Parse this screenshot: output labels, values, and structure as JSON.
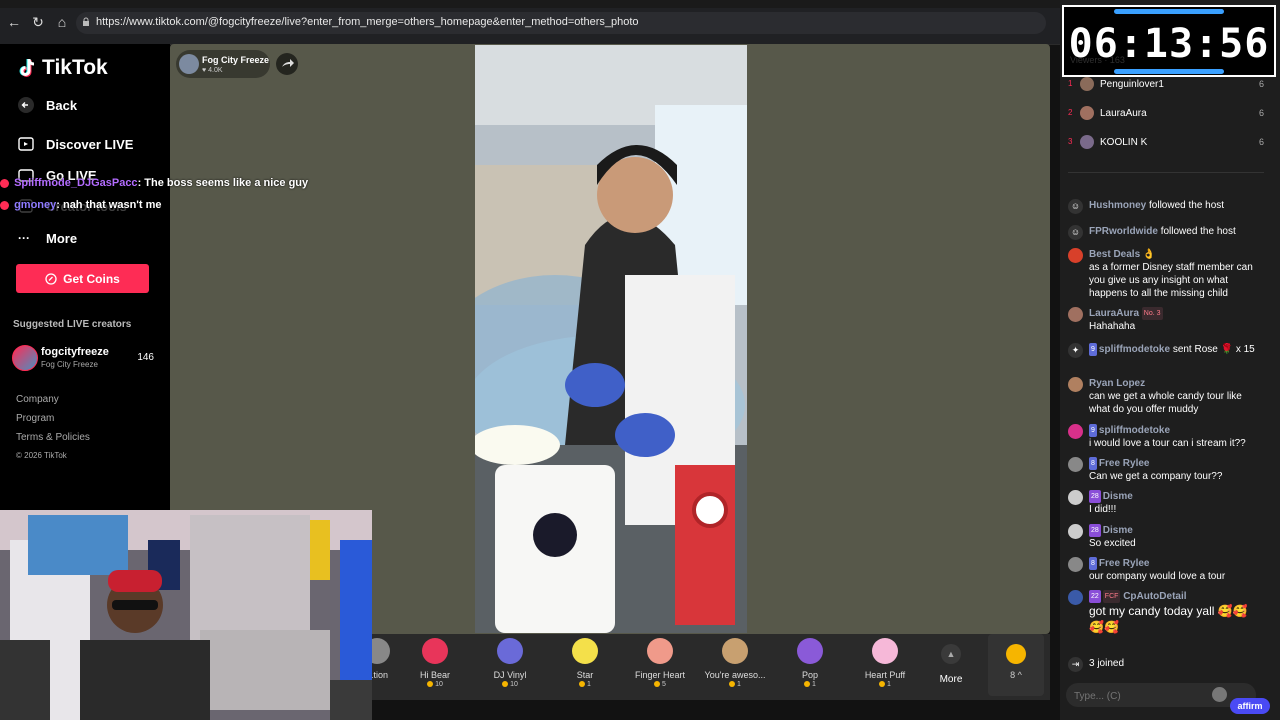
{
  "browser": {
    "url": "https://www.tiktok.com/@fogcityfreeze/live?enter_from_merge=others_homepage&enter_method=others_photo"
  },
  "sidebar": {
    "logo": "TikTok",
    "items": [
      {
        "label": "Back"
      },
      {
        "label": "Discover LIVE"
      },
      {
        "label": "Go LIVE"
      },
      {
        "label": "Creator tools"
      },
      {
        "label": "More"
      }
    ],
    "coins_button": "Get Coins",
    "suggested_title": "Suggested LIVE creators",
    "creator": {
      "name": "fogcityfreeze",
      "sub": "Fog City Freeze",
      "count": "146"
    },
    "footer": [
      "Company",
      "Program",
      "Terms & Policies"
    ],
    "copyright": "© 2026 TikTok"
  },
  "overlay_chat": [
    {
      "user": "Spliffmode_DJGasPacc",
      "text": ": The boss seems like a nice guy"
    },
    {
      "user": "gmoney",
      "text": ": nah that wasn't me"
    }
  ],
  "host": {
    "name": "Fog City Freeze",
    "likes": "♥ 4.0K"
  },
  "gifts": [
    {
      "name": "...tion",
      "price": ""
    },
    {
      "name": "Hi Bear",
      "price": "10"
    },
    {
      "name": "DJ Vinyl",
      "price": "10"
    },
    {
      "name": "Star",
      "price": "1"
    },
    {
      "name": "Finger Heart",
      "price": "5"
    },
    {
      "name": "You're aweso...",
      "price": "1"
    },
    {
      "name": "Pop",
      "price": "1"
    },
    {
      "name": "Heart Puff",
      "price": "1"
    }
  ],
  "gift_more": "More",
  "coin_balance": "8 ^",
  "timer": "06:13:56",
  "chat": {
    "viewers_label": "Viewers · 163",
    "top_viewers": [
      {
        "rank": "1",
        "name": "Penguinlover1",
        "score": "6"
      },
      {
        "rank": "2",
        "name": "LauraAura",
        "score": "6"
      },
      {
        "rank": "3",
        "name": "KOOLIN K",
        "score": "6"
      }
    ],
    "messages": [
      {
        "name": "Hushmoney",
        "text": "followed the host"
      },
      {
        "name": "FPRworldwide",
        "text": "followed the host"
      },
      {
        "name": "Best Deals 👌",
        "text": "as a former Disney staff member can you give us any insight on what happens to all the missing child"
      },
      {
        "name": "LauraAura",
        "tag": "No. 3",
        "text": "Hahahaha"
      },
      {
        "name": "spliffmodetoke",
        "level": "9",
        "text": "sent Rose 🌹 x 15"
      },
      {
        "name": "Ryan Lopez",
        "text": "can we get a whole candy tour like what do you offer muddy"
      },
      {
        "name": "spliffmodetoke",
        "level": "9",
        "text": "i would love a tour can i stream it??"
      },
      {
        "name": "Free Rylee",
        "level": "8",
        "text": "Can we get a company tour??"
      },
      {
        "name": "Disme",
        "level": "28",
        "text": "I did!!!"
      },
      {
        "name": "Disme",
        "level": "28",
        "text": "So excited"
      },
      {
        "name": "Free Rylee",
        "level": "8",
        "text": "our company would love a tour"
      },
      {
        "name": "CpAutoDetail",
        "level": "22",
        "tag": "FCF",
        "text": "got my candy today yall 🥰🥰🥰🥰"
      }
    ],
    "joined": "3 joined",
    "input_placeholder": "Type... (C)",
    "affirm": "affirm"
  },
  "colors": {
    "accent": "#fe2c55",
    "panel": "#1e1e1e",
    "stream_bg": "#57584a"
  }
}
